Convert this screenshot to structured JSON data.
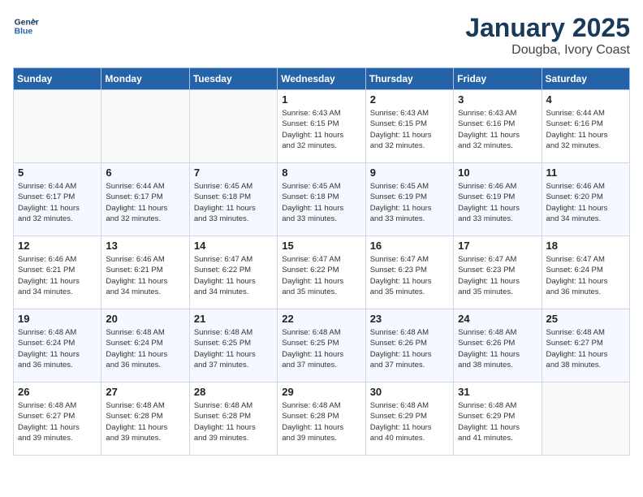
{
  "header": {
    "logo_line1": "General",
    "logo_line2": "Blue",
    "month": "January 2025",
    "location": "Dougba, Ivory Coast"
  },
  "weekdays": [
    "Sunday",
    "Monday",
    "Tuesday",
    "Wednesday",
    "Thursday",
    "Friday",
    "Saturday"
  ],
  "weeks": [
    [
      {
        "day": "",
        "info": ""
      },
      {
        "day": "",
        "info": ""
      },
      {
        "day": "",
        "info": ""
      },
      {
        "day": "1",
        "info": "Sunrise: 6:43 AM\nSunset: 6:15 PM\nDaylight: 11 hours\nand 32 minutes."
      },
      {
        "day": "2",
        "info": "Sunrise: 6:43 AM\nSunset: 6:15 PM\nDaylight: 11 hours\nand 32 minutes."
      },
      {
        "day": "3",
        "info": "Sunrise: 6:43 AM\nSunset: 6:16 PM\nDaylight: 11 hours\nand 32 minutes."
      },
      {
        "day": "4",
        "info": "Sunrise: 6:44 AM\nSunset: 6:16 PM\nDaylight: 11 hours\nand 32 minutes."
      }
    ],
    [
      {
        "day": "5",
        "info": "Sunrise: 6:44 AM\nSunset: 6:17 PM\nDaylight: 11 hours\nand 32 minutes."
      },
      {
        "day": "6",
        "info": "Sunrise: 6:44 AM\nSunset: 6:17 PM\nDaylight: 11 hours\nand 32 minutes."
      },
      {
        "day": "7",
        "info": "Sunrise: 6:45 AM\nSunset: 6:18 PM\nDaylight: 11 hours\nand 33 minutes."
      },
      {
        "day": "8",
        "info": "Sunrise: 6:45 AM\nSunset: 6:18 PM\nDaylight: 11 hours\nand 33 minutes."
      },
      {
        "day": "9",
        "info": "Sunrise: 6:45 AM\nSunset: 6:19 PM\nDaylight: 11 hours\nand 33 minutes."
      },
      {
        "day": "10",
        "info": "Sunrise: 6:46 AM\nSunset: 6:19 PM\nDaylight: 11 hours\nand 33 minutes."
      },
      {
        "day": "11",
        "info": "Sunrise: 6:46 AM\nSunset: 6:20 PM\nDaylight: 11 hours\nand 34 minutes."
      }
    ],
    [
      {
        "day": "12",
        "info": "Sunrise: 6:46 AM\nSunset: 6:21 PM\nDaylight: 11 hours\nand 34 minutes."
      },
      {
        "day": "13",
        "info": "Sunrise: 6:46 AM\nSunset: 6:21 PM\nDaylight: 11 hours\nand 34 minutes."
      },
      {
        "day": "14",
        "info": "Sunrise: 6:47 AM\nSunset: 6:22 PM\nDaylight: 11 hours\nand 34 minutes."
      },
      {
        "day": "15",
        "info": "Sunrise: 6:47 AM\nSunset: 6:22 PM\nDaylight: 11 hours\nand 35 minutes."
      },
      {
        "day": "16",
        "info": "Sunrise: 6:47 AM\nSunset: 6:23 PM\nDaylight: 11 hours\nand 35 minutes."
      },
      {
        "day": "17",
        "info": "Sunrise: 6:47 AM\nSunset: 6:23 PM\nDaylight: 11 hours\nand 35 minutes."
      },
      {
        "day": "18",
        "info": "Sunrise: 6:47 AM\nSunset: 6:24 PM\nDaylight: 11 hours\nand 36 minutes."
      }
    ],
    [
      {
        "day": "19",
        "info": "Sunrise: 6:48 AM\nSunset: 6:24 PM\nDaylight: 11 hours\nand 36 minutes."
      },
      {
        "day": "20",
        "info": "Sunrise: 6:48 AM\nSunset: 6:24 PM\nDaylight: 11 hours\nand 36 minutes."
      },
      {
        "day": "21",
        "info": "Sunrise: 6:48 AM\nSunset: 6:25 PM\nDaylight: 11 hours\nand 37 minutes."
      },
      {
        "day": "22",
        "info": "Sunrise: 6:48 AM\nSunset: 6:25 PM\nDaylight: 11 hours\nand 37 minutes."
      },
      {
        "day": "23",
        "info": "Sunrise: 6:48 AM\nSunset: 6:26 PM\nDaylight: 11 hours\nand 37 minutes."
      },
      {
        "day": "24",
        "info": "Sunrise: 6:48 AM\nSunset: 6:26 PM\nDaylight: 11 hours\nand 38 minutes."
      },
      {
        "day": "25",
        "info": "Sunrise: 6:48 AM\nSunset: 6:27 PM\nDaylight: 11 hours\nand 38 minutes."
      }
    ],
    [
      {
        "day": "26",
        "info": "Sunrise: 6:48 AM\nSunset: 6:27 PM\nDaylight: 11 hours\nand 39 minutes."
      },
      {
        "day": "27",
        "info": "Sunrise: 6:48 AM\nSunset: 6:28 PM\nDaylight: 11 hours\nand 39 minutes."
      },
      {
        "day": "28",
        "info": "Sunrise: 6:48 AM\nSunset: 6:28 PM\nDaylight: 11 hours\nand 39 minutes."
      },
      {
        "day": "29",
        "info": "Sunrise: 6:48 AM\nSunset: 6:28 PM\nDaylight: 11 hours\nand 39 minutes."
      },
      {
        "day": "30",
        "info": "Sunrise: 6:48 AM\nSunset: 6:29 PM\nDaylight: 11 hours\nand 40 minutes."
      },
      {
        "day": "31",
        "info": "Sunrise: 6:48 AM\nSunset: 6:29 PM\nDaylight: 11 hours\nand 41 minutes."
      },
      {
        "day": "",
        "info": ""
      }
    ]
  ]
}
